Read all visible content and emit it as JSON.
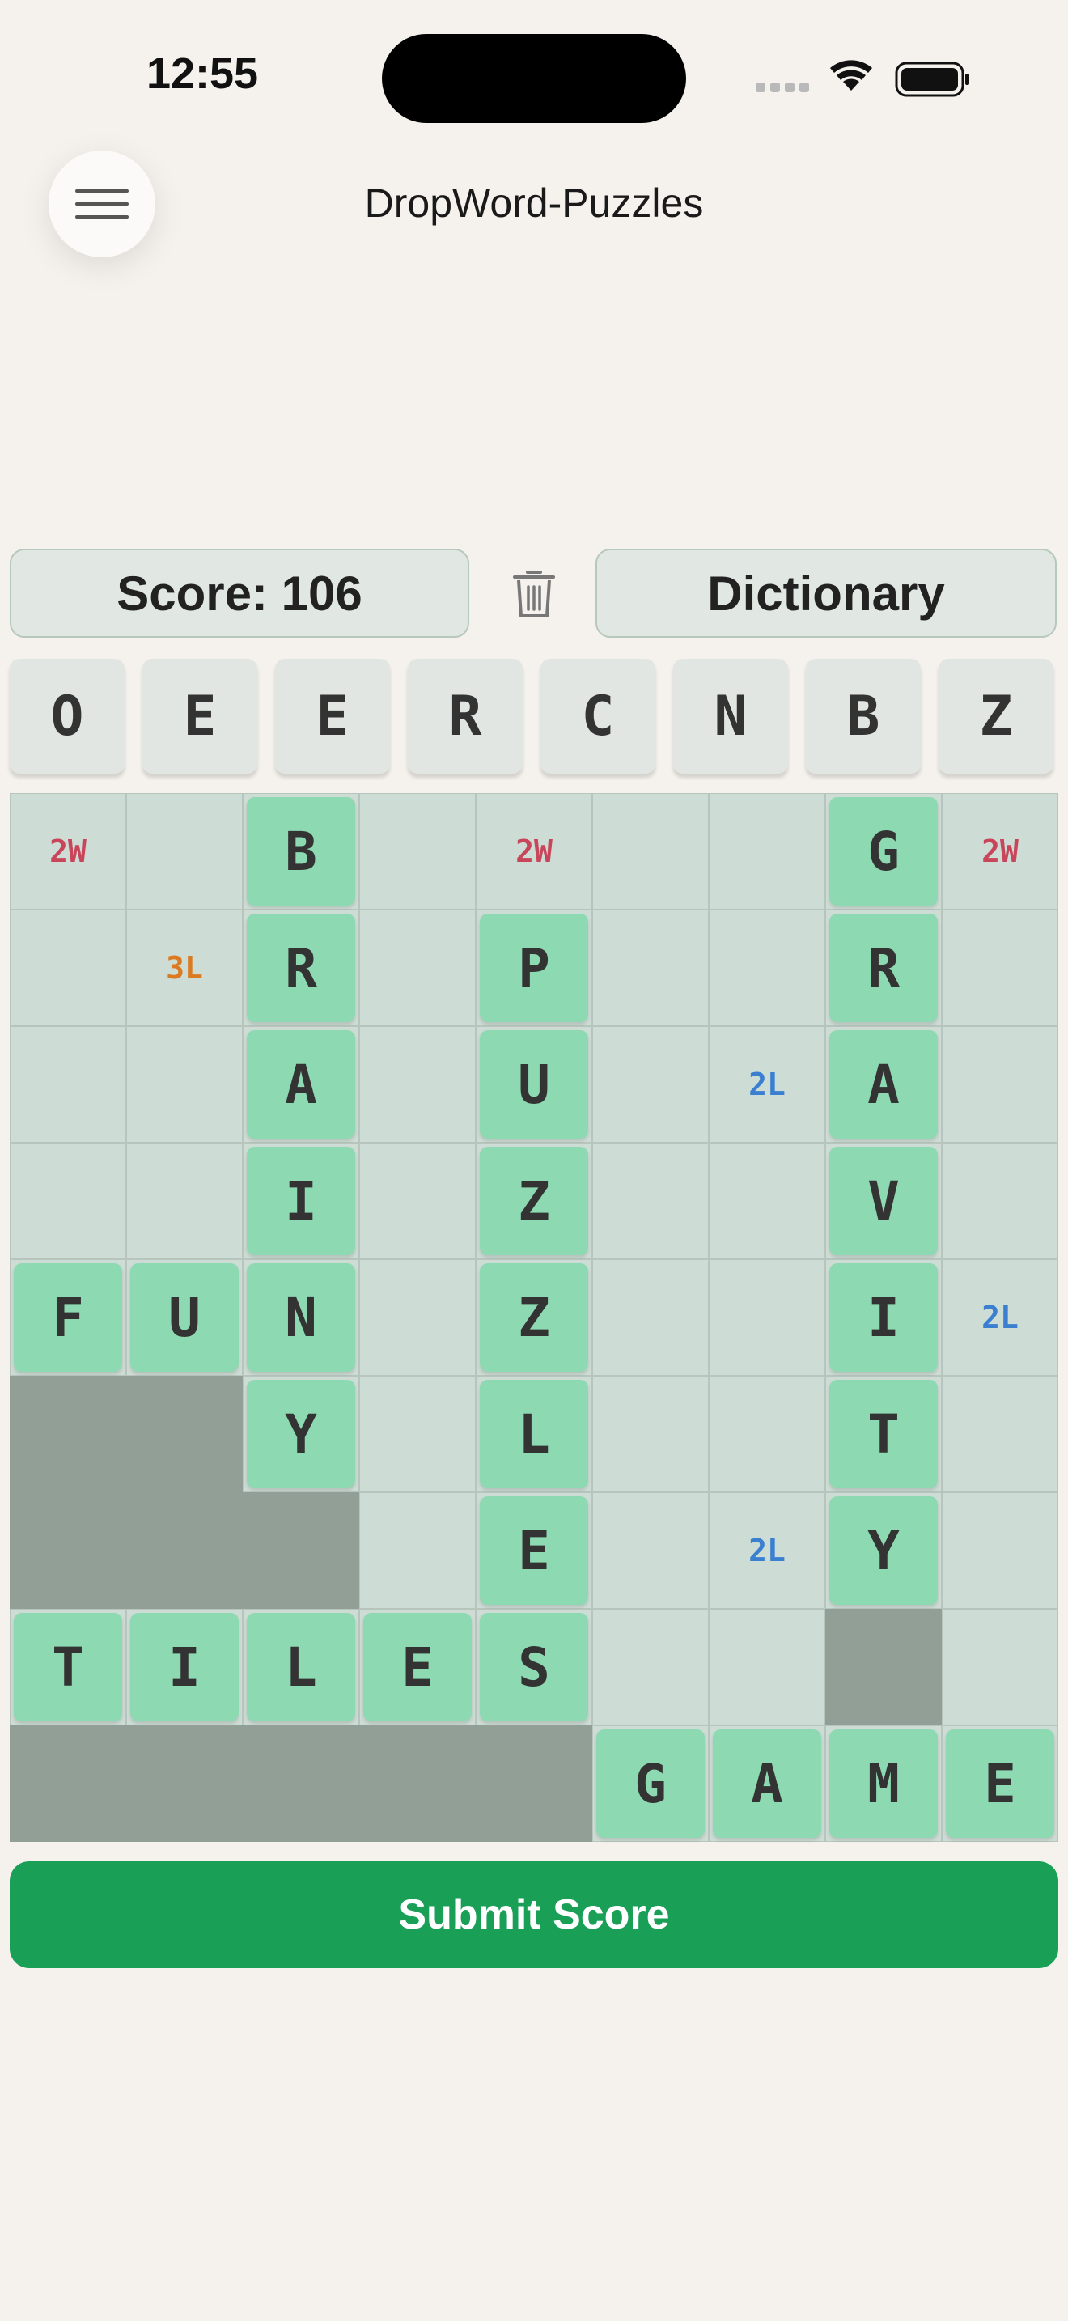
{
  "status": {
    "time": "12:55"
  },
  "app": {
    "title": "DropWord-Puzzles"
  },
  "toolbar": {
    "score_label": "Score: 106",
    "dictionary_label": "Dictionary"
  },
  "rack": [
    "O",
    "E",
    "E",
    "R",
    "C",
    "N",
    "B",
    "Z"
  ],
  "board": {
    "rows": [
      [
        "2W",
        "",
        "B",
        "",
        "2W",
        "",
        "",
        "G",
        "2W"
      ],
      [
        "",
        "3L",
        "R",
        "",
        "P",
        "",
        "",
        "R",
        ""
      ],
      [
        "",
        "",
        "A",
        "",
        "U",
        "",
        "2L",
        "A",
        ""
      ],
      [
        "",
        "",
        "I",
        "",
        "Z",
        "",
        "",
        "V",
        ""
      ],
      [
        "F",
        "U",
        "N",
        "",
        "Z",
        "",
        "",
        "I",
        "2L"
      ],
      [
        "#",
        "#",
        "Y",
        "",
        "L",
        "",
        "",
        "T",
        ""
      ],
      [
        "#",
        "#",
        "#",
        "",
        "E",
        "",
        "2L",
        "Y",
        ""
      ],
      [
        "T",
        "I",
        "L",
        "E",
        "S",
        "",
        "",
        "#",
        ""
      ],
      [
        "#",
        "#",
        "#",
        "#",
        "#",
        "G",
        "A",
        "M",
        "E"
      ]
    ]
  },
  "actions": {
    "submit_label": "Submit Score"
  },
  "colors": {
    "accent": "#1a9f57",
    "tile": "#8dd9b2",
    "bonus_2w": "#c8455a",
    "bonus_3l": "#dc7a22",
    "bonus_2l": "#3a7fd0",
    "blocked": "#919f96"
  }
}
